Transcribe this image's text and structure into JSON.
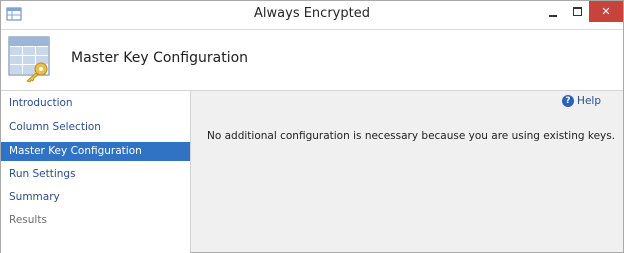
{
  "window": {
    "title": "Always Encrypted",
    "close_glyph": "✕"
  },
  "header": {
    "title": "Master Key Configuration",
    "icon": "table-key-icon"
  },
  "sidebar": {
    "items": [
      {
        "label": "Introduction",
        "state": "link"
      },
      {
        "label": "Column Selection",
        "state": "link"
      },
      {
        "label": "Master Key Configuration",
        "state": "active"
      },
      {
        "label": "Run Settings",
        "state": "link"
      },
      {
        "label": "Summary",
        "state": "link"
      },
      {
        "label": "Results",
        "state": "disabled"
      }
    ]
  },
  "content": {
    "help_label": "Help",
    "help_glyph": "?",
    "message": "No additional configuration is necessary because you are using existing keys."
  },
  "colors": {
    "accent": "#3072c4",
    "link": "#2b4d8c",
    "close": "#c7433b",
    "content_bg": "#f0f0f0"
  }
}
